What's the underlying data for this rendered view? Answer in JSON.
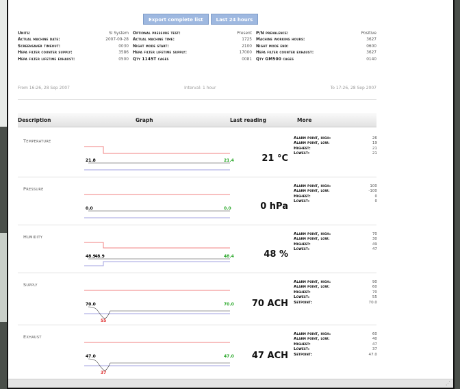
{
  "toolbar": {
    "export_label": "Export complete list",
    "last24_label": "Last 24 hours"
  },
  "settings": [
    [
      [
        "Units:",
        "SI System"
      ],
      [
        "Optional pressure test:",
        "Present"
      ],
      [
        "P/N prevalence:",
        "Positive"
      ]
    ],
    [
      [
        "Actual machine date:",
        "2007-09-28"
      ],
      [
        "Actual machine time:",
        "1725"
      ],
      [
        "Machine working hours:",
        "3627"
      ]
    ],
    [
      [
        "Screensaver timeout:",
        "0030"
      ],
      [
        "Night mode start:",
        "2100"
      ],
      [
        "Night mode end:",
        "0600"
      ]
    ],
    [
      [
        "Hepa filter counter supply:",
        "3586"
      ],
      [
        "Hepa filter lifetime supply:",
        "17000"
      ],
      [
        "Hepa filter counter exhaust:",
        "3627"
      ]
    ],
    [
      [
        "Hepa filter lifetime exhaust:",
        "0500"
      ],
      [
        "Qty 1145T cages",
        "0081"
      ],
      [
        "Qty GM500 cages",
        "0140"
      ]
    ]
  ],
  "range": {
    "from": "From 16:26, 28 Sep 2007",
    "interval": "Interval: 1 hour",
    "to": "To 17:26, 28 Sep 2007"
  },
  "table": {
    "col_description": "Description",
    "col_graph": "Graph",
    "col_last": "Last reading",
    "col_more": "More"
  },
  "rows": [
    {
      "name": "Temperature",
      "reading": "21 °C",
      "start_label": "21.8",
      "end_label": "21.4",
      "stats": [
        [
          "Alarm point, high:",
          "26"
        ],
        [
          "Alarm point, low:",
          "19"
        ],
        [
          "Highest:",
          "21"
        ],
        [
          "Lowest:",
          "21"
        ]
      ]
    },
    {
      "name": "Pressure",
      "reading": "0 hPa",
      "start_label": "0.0",
      "end_label": "0.0",
      "stats": [
        [
          "Alarm point, high:",
          "100"
        ],
        [
          "Alarm point, low:",
          "-100"
        ],
        [
          "Highest:",
          "0"
        ],
        [
          "Lowest:",
          "0"
        ]
      ]
    },
    {
      "name": "Humidity",
      "reading": "48 %",
      "start_label": "48.9",
      "end_label": "48.4",
      "stats": [
        [
          "Alarm point, high:",
          "70"
        ],
        [
          "Alarm point, low:",
          "30"
        ],
        [
          "Highest:",
          "49"
        ],
        [
          "Lowest:",
          "47"
        ]
      ]
    },
    {
      "name": "Supply",
      "reading": "70 ACH",
      "start_label": "70.0",
      "end_label": "70.0",
      "stats": [
        [
          "Alarm point, high:",
          "90"
        ],
        [
          "Alarm point, low:",
          "60"
        ],
        [
          "Highest:",
          "70"
        ],
        [
          "Lowest:",
          "55"
        ],
        [
          "Setpoint:",
          "70.0"
        ]
      ]
    },
    {
      "name": "Exhaust",
      "reading": "47 ACH",
      "start_label": "47.0",
      "end_label": "47.0",
      "stats": [
        [
          "Alarm point, high:",
          "60"
        ],
        [
          "Alarm point, low:",
          "40"
        ],
        [
          "Highest:",
          "47"
        ],
        [
          "Lowest:",
          "37"
        ],
        [
          "Setpoint:",
          "47.0"
        ]
      ]
    }
  ],
  "colors": {
    "alarm_high": "#f08080",
    "alarm_low": "#a0a0e0",
    "trace": "#333333",
    "start_mark": "#000000",
    "end_mark": "#2aa82a",
    "dip_mark": "#e03030"
  }
}
